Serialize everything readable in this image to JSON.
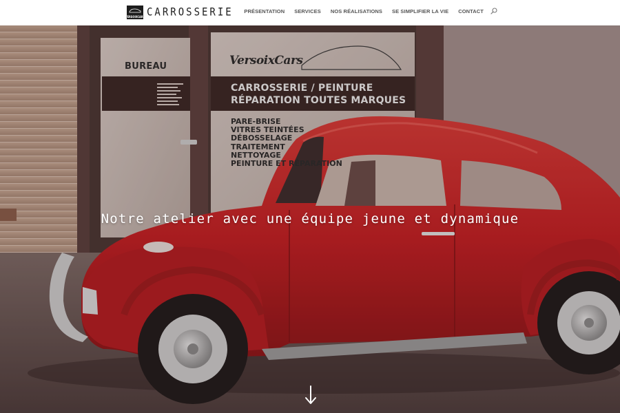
{
  "header": {
    "logo": {
      "badge_text": "VERSOIXCARS",
      "wordmark": "CARROSSERIE"
    },
    "nav": [
      {
        "label": "PRÉSENTATION"
      },
      {
        "label": "SERVICES"
      },
      {
        "label": "NOS RÉALISATIONS"
      },
      {
        "label": "SE SIMPLIFIER LA VIE"
      },
      {
        "label": "CONTACT"
      }
    ],
    "search_icon": "search-icon"
  },
  "hero": {
    "title": "Notre atelier avec une équipe jeune et dynamique",
    "scroll_icon": "arrow-down-icon",
    "window_sign": {
      "door_label": "BUREAU",
      "brand": "VersoixCars",
      "band_line_1": "CARROSSERIE / PEINTURE",
      "band_line_2": "RÉPARATION TOUTES MARQUES",
      "services": [
        "PARE-BRISE",
        "VITRES TEINTÉES",
        "DÉBOSSELAGE",
        "TRAITEMENT",
        "NETTOYAGE",
        "PEINTURE ET RÉPARATION"
      ]
    }
  },
  "colors": {
    "car_red": "#c41e22",
    "header_bg": "#ffffff",
    "nav_text": "#555555",
    "title_text": "#ffffff"
  }
}
